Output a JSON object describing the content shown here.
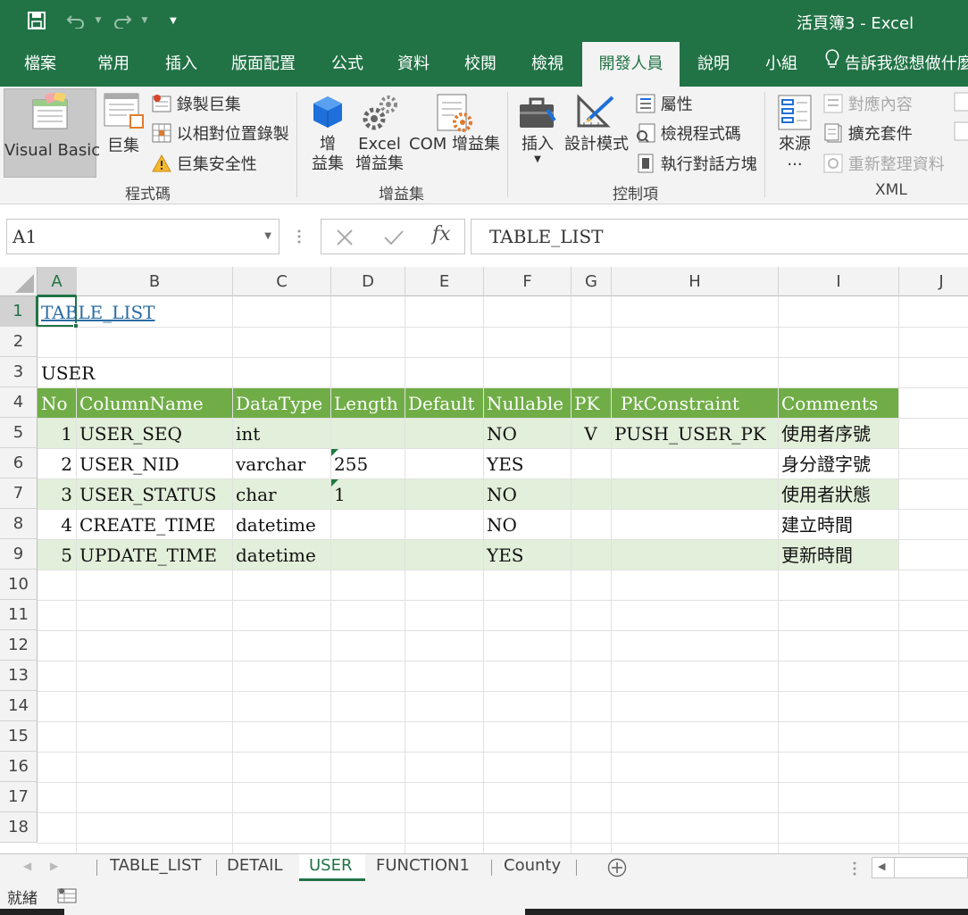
{
  "window": {
    "title": "活頁簿3  -  Excel"
  },
  "ribbon_tabs": [
    "檔案",
    "常用",
    "插入",
    "版面配置",
    "公式",
    "資料",
    "校閱",
    "檢視",
    "開發人員",
    "說明",
    "小組",
    "告訴我您想做什麼"
  ],
  "ribbon": {
    "code": {
      "visual_basic": "Visual Basic",
      "macros": "巨集",
      "record_macro": "錄製巨集",
      "relative_ref": "以相對位置錄製",
      "macro_security": "巨集安全性",
      "label": "程式碼"
    },
    "addins": {
      "addins_1": "增",
      "addins_2": "益集",
      "excel_addins_1": "Excel",
      "excel_addins_2": "增益集",
      "com_addins": "COM 增益集",
      "label": "增益集"
    },
    "controls": {
      "insert": "插入",
      "design_mode": "設計模式",
      "properties": "屬性",
      "view_code": "檢視程式碼",
      "run_dialog": "執行對話方塊",
      "label": "控制項"
    },
    "xml": {
      "source_1": "來源",
      "source_2": "...",
      "map_properties": "對應內容",
      "expansion_packs": "擴充套件",
      "refresh_data": "重新整理資料",
      "label": "XML"
    }
  },
  "formula_bar": {
    "name_box": "A1",
    "formula": "TABLE_LIST"
  },
  "grid": {
    "columns": [
      "A",
      "B",
      "C",
      "D",
      "E",
      "F",
      "G",
      "H",
      "I",
      "J"
    ],
    "rows": [
      "1",
      "2",
      "3",
      "4",
      "5",
      "6",
      "7",
      "8",
      "9",
      "10",
      "11",
      "12",
      "13",
      "14",
      "15",
      "16",
      "17",
      "18"
    ],
    "a1_link": "TABLE_LIST",
    "a3": "USER",
    "table_headers": [
      "No",
      "ColumnName",
      "DataType",
      "Length",
      "Default",
      "Nullable",
      "PK",
      "PkConstraint",
      "Comments"
    ],
    "table_rows": [
      [
        "1",
        "USER_SEQ",
        "int",
        "",
        "",
        "NO",
        "V",
        "PUSH_USER_PK",
        "使用者序號"
      ],
      [
        "2",
        "USER_NID",
        "varchar",
        "255",
        "",
        "YES",
        "",
        "",
        "身分證字號"
      ],
      [
        "3",
        "USER_STATUS",
        "char",
        "1",
        "",
        "NO",
        "",
        "",
        "使用者狀態"
      ],
      [
        "4",
        "CREATE_TIME",
        "datetime",
        "",
        "",
        "NO",
        "",
        "",
        "建立時間"
      ],
      [
        "5",
        "UPDATE_TIME",
        "datetime",
        "",
        "",
        "YES",
        "",
        "",
        "更新時間"
      ]
    ]
  },
  "sheet_tabs": [
    "TABLE_LIST",
    "DETAIL",
    "USER",
    "FUNCTION1",
    "County"
  ],
  "active_sheet": "USER",
  "status": {
    "ready": "就緒"
  },
  "colors": {
    "excel_green": "#217346",
    "table_header": "#70ad47",
    "band_row": "#e2efda"
  }
}
